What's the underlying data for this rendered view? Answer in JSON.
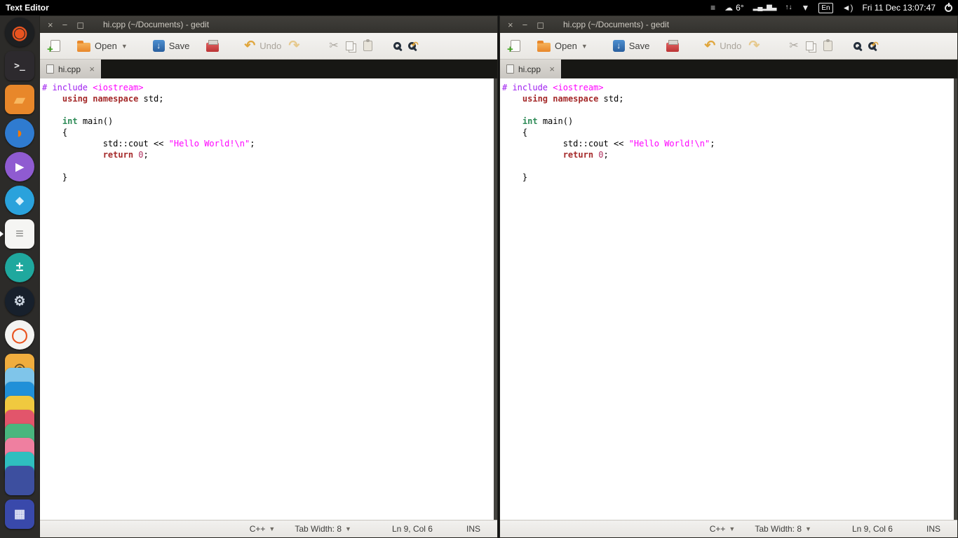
{
  "topbar": {
    "app_name": "Text Editor",
    "temperature": "6°",
    "keyboard_layout": "En",
    "clock": "Fri 11 Dec 13:07:47"
  },
  "launcher": {
    "items": [
      {
        "id": "ubuntu",
        "shape": "circle",
        "bg": "#1d1f21",
        "glyph": "◉",
        "glyphColor": "#e95420",
        "glyphSize": 26
      },
      {
        "id": "terminal",
        "bg": "#2d2a2e",
        "glyph": ">_",
        "glyphColor": "#e6e6e6",
        "glyphSize": 13,
        "mono": true
      },
      {
        "id": "files",
        "bg": "#e8872a",
        "glyph": "▰",
        "glyphColor": "#f8b860",
        "glyphSize": 20
      },
      {
        "id": "firefox",
        "shape": "circle",
        "bg": "#2f7bd0",
        "glyph": "◗",
        "glyphColor": "#f57900",
        "glyphSize": 22
      },
      {
        "id": "videos",
        "shape": "circle",
        "bg": "#8f5bd1",
        "glyph": "▶",
        "glyphColor": "#ffffff",
        "glyphSize": 15
      },
      {
        "id": "water-drop",
        "shape": "circle",
        "bg": "#2aa2dc",
        "glyph": "◆",
        "glyphColor": "#d6f0fb",
        "glyphSize": 15
      },
      {
        "id": "text-editor",
        "bg": "#f5f5f3",
        "glyph": "≡",
        "glyphColor": "#8a8a88",
        "glyphSize": 20,
        "running": true
      },
      {
        "id": "calculator",
        "shape": "circle",
        "bg": "#1fa89e",
        "glyph": "±",
        "glyphColor": "#ffffff",
        "glyphSize": 19
      },
      {
        "id": "steam",
        "shape": "circle",
        "bg": "#17202c",
        "glyph": "⚙",
        "glyphColor": "#cfd8e3",
        "glyphSize": 19
      },
      {
        "id": "software-center",
        "shape": "circle",
        "bg": "#f4f4f2",
        "glyph": "◯",
        "glyphColor": "#e95420",
        "glyphSize": 21
      },
      {
        "id": "camera",
        "bg": "#f0ad3e",
        "glyph": "◎",
        "glyphColor": "#6b4e1f",
        "glyphSize": 19
      },
      {
        "id": "stack-1",
        "stacked": true,
        "bg": "#7fc5ea"
      },
      {
        "id": "stack-2",
        "stacked": true,
        "bg": "#2090d8"
      },
      {
        "id": "stack-3",
        "stacked": true,
        "bg": "#f0c93f"
      },
      {
        "id": "stack-4",
        "stacked": true,
        "bg": "#e2556b"
      },
      {
        "id": "stack-5",
        "stacked": true,
        "bg": "#49b67e"
      },
      {
        "id": "stack-6",
        "stacked": true,
        "bg": "#ef7fa0"
      },
      {
        "id": "stack-7",
        "stacked": true,
        "bg": "#2fbfbf"
      },
      {
        "id": "stack-8",
        "stacked": true,
        "bg": "#3d4f9f"
      },
      {
        "id": "workspaces",
        "bg": "#3949ab",
        "glyph": "▦",
        "glyphColor": "#dfe3f5",
        "glyphSize": 17
      }
    ]
  },
  "window": {
    "title": "hi.cpp (~/Documents) - gedit",
    "controls": {
      "close": "×",
      "minimize": "−",
      "maximize": "◻"
    },
    "toolbar": {
      "open_label": "Open",
      "save_label": "Save",
      "undo_label": "Undo"
    },
    "tab": {
      "label": "hi.cpp",
      "close": "×"
    },
    "statusbar": {
      "language": "C++",
      "tab_width": "Tab Width: 8",
      "cursor_position": "Ln 9, Col 6",
      "input_mode": "INS"
    }
  },
  "code": {
    "palette": {
      "plain": {
        "color": "#000000"
      },
      "preprocessor": {
        "color": "#a020f0"
      },
      "include": {
        "color": "#ff00ff"
      },
      "keyword": {
        "color": "#a52a2a",
        "bold": true
      },
      "type": {
        "color": "#2e8b57",
        "bold": true
      },
      "string": {
        "color": "#ff00ff"
      },
      "number": {
        "color": "#b03060"
      }
    },
    "lines": [
      [
        [
          "preprocessor",
          "# include "
        ],
        [
          "include",
          "<iostream>"
        ]
      ],
      [
        [
          "plain",
          "    "
        ],
        [
          "keyword",
          "using"
        ],
        [
          "plain",
          " "
        ],
        [
          "keyword",
          "namespace"
        ],
        [
          "plain",
          " std;"
        ]
      ],
      [],
      [
        [
          "plain",
          "    "
        ],
        [
          "type",
          "int"
        ],
        [
          "plain",
          " main()"
        ]
      ],
      [
        [
          "plain",
          "    {"
        ]
      ],
      [
        [
          "plain",
          "            std::cout << "
        ],
        [
          "string",
          "\"Hello World!\\n\""
        ],
        [
          "plain",
          ";"
        ]
      ],
      [
        [
          "plain",
          "            "
        ],
        [
          "keyword",
          "return"
        ],
        [
          "plain",
          " "
        ],
        [
          "number",
          "0"
        ],
        [
          "plain",
          ";"
        ]
      ],
      [],
      [
        [
          "plain",
          "    }"
        ]
      ]
    ]
  }
}
